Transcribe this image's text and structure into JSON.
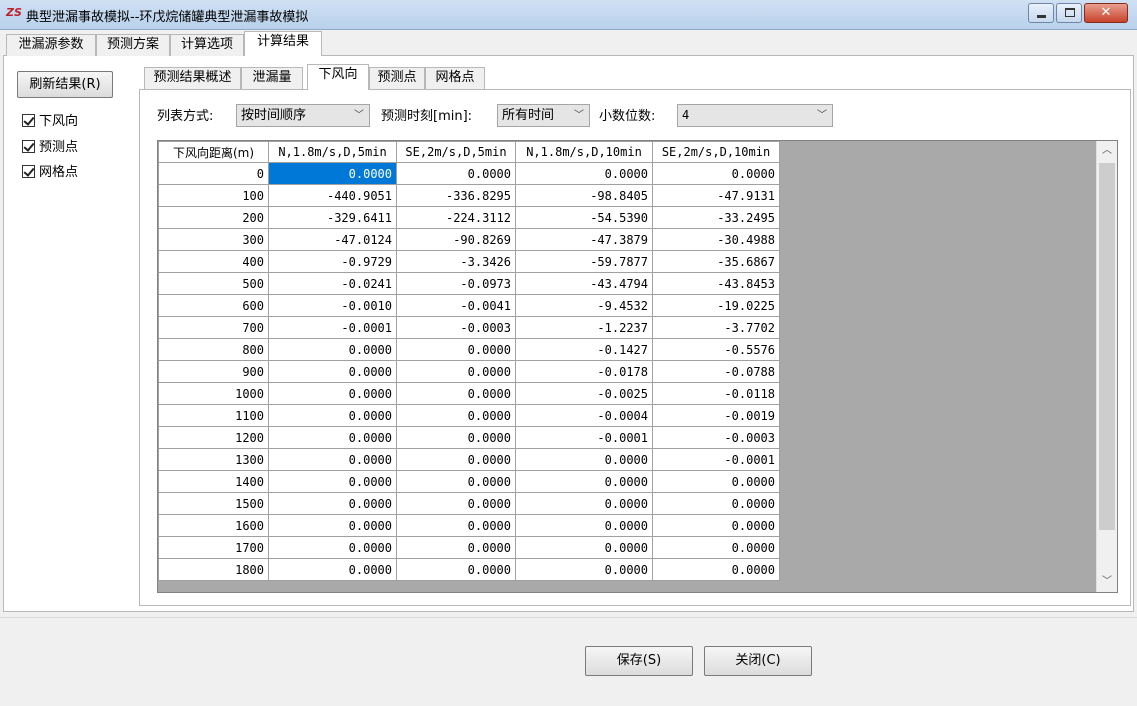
{
  "window": {
    "title": "典型泄漏事故模拟--环戊烷储罐典型泄漏事故模拟",
    "app_icon": "app-logo-icon",
    "controls": [
      "minimize-icon",
      "maximize-icon",
      "close-icon"
    ]
  },
  "top_tabs": [
    "泄漏源参数",
    "预测方案",
    "计算选项",
    "计算结果"
  ],
  "top_tab_active": "计算结果",
  "sidebar": {
    "refresh_label": "刷新结果(R)",
    "checkboxes": [
      {
        "label": "下风向",
        "checked": true
      },
      {
        "label": "预测点",
        "checked": true
      },
      {
        "label": "网格点",
        "checked": true
      }
    ]
  },
  "inner_tabs": [
    "预测结果概述",
    "泄漏量",
    "下风向",
    "预测点",
    "网格点"
  ],
  "inner_tab_active": "下风向",
  "filters": {
    "list_mode_label": "列表方式:",
    "list_mode_value": "按时间顺序",
    "time_label": "预测时刻[min]:",
    "time_value": "所有时间",
    "decimals_label": "小数位数:",
    "decimals_value": "4"
  },
  "grid": {
    "row_header": "下风向距离(m)",
    "columns": [
      "N,1.8m/s,D,5min",
      "SE,2m/s,D,5min",
      "N,1.8m/s,D,10min",
      "SE,2m/s,D,10min"
    ],
    "rows": [
      {
        "d": "0",
        "v": [
          "0.0000",
          "0.0000",
          "0.0000",
          "0.0000"
        ]
      },
      {
        "d": "100",
        "v": [
          "-440.9051",
          "-336.8295",
          "-98.8405",
          "-47.9131"
        ]
      },
      {
        "d": "200",
        "v": [
          "-329.6411",
          "-224.3112",
          "-54.5390",
          "-33.2495"
        ]
      },
      {
        "d": "300",
        "v": [
          "-47.0124",
          "-90.8269",
          "-47.3879",
          "-30.4988"
        ]
      },
      {
        "d": "400",
        "v": [
          "-0.9729",
          "-3.3426",
          "-59.7877",
          "-35.6867"
        ]
      },
      {
        "d": "500",
        "v": [
          "-0.0241",
          "-0.0973",
          "-43.4794",
          "-43.8453"
        ]
      },
      {
        "d": "600",
        "v": [
          "-0.0010",
          "-0.0041",
          "-9.4532",
          "-19.0225"
        ]
      },
      {
        "d": "700",
        "v": [
          "-0.0001",
          "-0.0003",
          "-1.2237",
          "-3.7702"
        ]
      },
      {
        "d": "800",
        "v": [
          "0.0000",
          "0.0000",
          "-0.1427",
          "-0.5576"
        ]
      },
      {
        "d": "900",
        "v": [
          "0.0000",
          "0.0000",
          "-0.0178",
          "-0.0788"
        ]
      },
      {
        "d": "1000",
        "v": [
          "0.0000",
          "0.0000",
          "-0.0025",
          "-0.0118"
        ]
      },
      {
        "d": "1100",
        "v": [
          "0.0000",
          "0.0000",
          "-0.0004",
          "-0.0019"
        ]
      },
      {
        "d": "1200",
        "v": [
          "0.0000",
          "0.0000",
          "-0.0001",
          "-0.0003"
        ]
      },
      {
        "d": "1300",
        "v": [
          "0.0000",
          "0.0000",
          "0.0000",
          "-0.0001"
        ]
      },
      {
        "d": "1400",
        "v": [
          "0.0000",
          "0.0000",
          "0.0000",
          "0.0000"
        ]
      },
      {
        "d": "1500",
        "v": [
          "0.0000",
          "0.0000",
          "0.0000",
          "0.0000"
        ]
      },
      {
        "d": "1600",
        "v": [
          "0.0000",
          "0.0000",
          "0.0000",
          "0.0000"
        ]
      },
      {
        "d": "1700",
        "v": [
          "0.0000",
          "0.0000",
          "0.0000",
          "0.0000"
        ]
      },
      {
        "d": "1800",
        "v": [
          "0.0000",
          "0.0000",
          "0.0000",
          "0.0000"
        ]
      }
    ],
    "selected_cell": {
      "row": 0,
      "col": 0
    }
  },
  "buttons": {
    "save_label": "保存(S)",
    "close_label": "关闭(C)"
  },
  "colors": {
    "selection": "#0078d7",
    "grid_empty": "#a9a9a9"
  }
}
